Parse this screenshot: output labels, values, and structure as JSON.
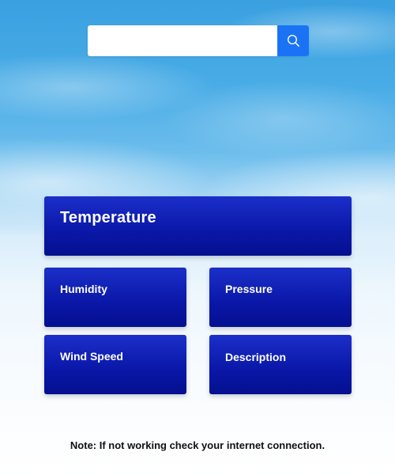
{
  "search": {
    "value": "",
    "placeholder": "",
    "button_icon": "search-icon",
    "button_color": "#1a73f5"
  },
  "weather": {
    "temperature_label": "Temperature",
    "humidity_label": "Humidity",
    "pressure_label": "Pressure",
    "wind_speed_label": "Wind Speed",
    "description_label": "Description",
    "card_color": "#0a17a7"
  },
  "footer": {
    "note": "Note: If not working check your internet connection."
  }
}
